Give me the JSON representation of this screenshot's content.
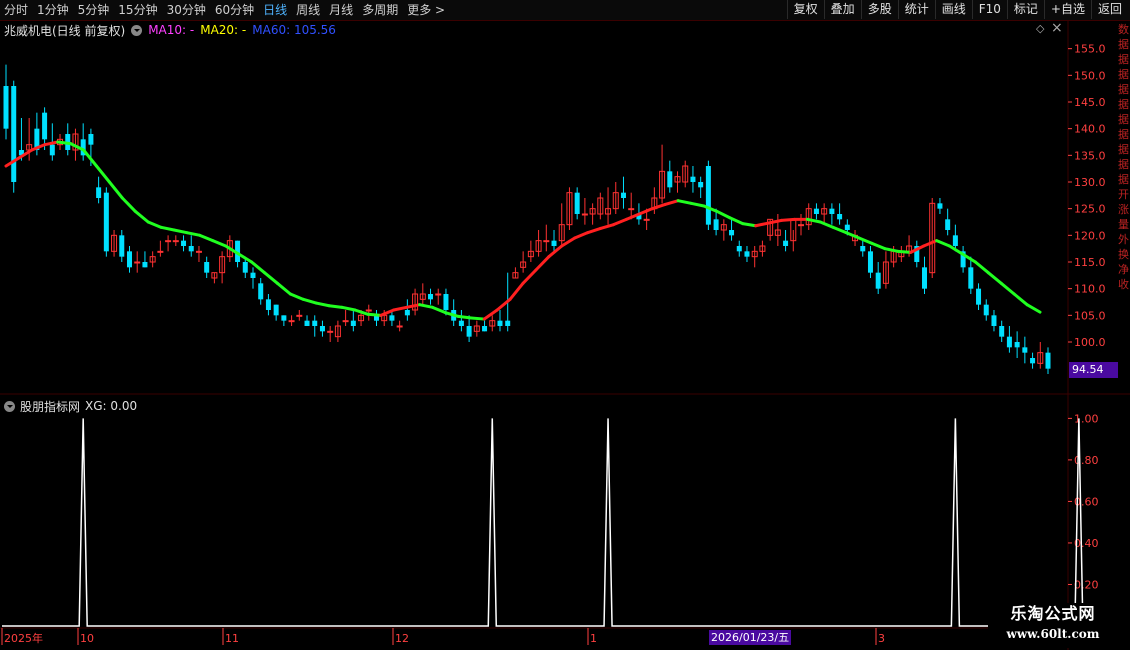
{
  "toolbar": {
    "periods": [
      "分时",
      "1分钟",
      "5分钟",
      "15分钟",
      "30分钟",
      "60分钟",
      "日线",
      "周线",
      "月线",
      "多周期",
      "更多 >"
    ],
    "active_period": "日线",
    "actions": [
      "复权",
      "叠加",
      "多股",
      "统计",
      "画线",
      "F10",
      "标记",
      "+自选",
      "返回"
    ]
  },
  "main_header": {
    "stock": "兆威机电(日线 前复权)",
    "ma10": "MA10: -",
    "ma20": "MA20: -",
    "ma60": "MA60: 105.56"
  },
  "sub_header": {
    "indicator": "股朋指标网",
    "xg": "XG: 0.00"
  },
  "right_strip": [
    "数",
    "据",
    "据",
    "据",
    "据",
    "据",
    "据",
    "据",
    "据",
    "据",
    "据",
    "开",
    "涨",
    "量",
    "外",
    "换",
    "净",
    "收"
  ],
  "last_price": "94.54",
  "date_tag": "2026/01/23/五",
  "watermark": {
    "line1": "乐淘公式网",
    "line2": "www.60lt.com"
  },
  "colors": {
    "up": "#ff3232",
    "down": "#00e0ff",
    "ma10": "#ff40ff",
    "ma20": "#ffff00",
    "ma60": "#3050ff",
    "grid": "#3a0000",
    "axis_text": "#ff4040",
    "signal": "#ffffff"
  },
  "chart_data": [
    {
      "type": "candlestick",
      "price_axis": {
        "ticks": [
          155.0,
          150.0,
          145.0,
          140.0,
          135.0,
          130.0,
          125.0,
          120.0,
          115.0,
          110.0,
          105.0,
          100.0
        ],
        "range": [
          91,
          157
        ]
      },
      "x_labels": [
        "2025年",
        "10",
        "11",
        "12",
        "1",
        "2026/01/23/五",
        "3"
      ],
      "candles": [
        [
          148,
          152,
          140,
          138
        ],
        [
          148,
          149,
          130,
          128
        ],
        [
          136,
          142,
          135,
          134
        ],
        [
          136,
          142,
          137,
          134
        ],
        [
          140,
          143,
          136,
          135
        ],
        [
          143,
          144,
          138,
          136
        ],
        [
          137,
          141,
          135,
          134
        ],
        [
          137,
          139,
          138,
          136
        ],
        [
          139,
          141,
          136,
          135
        ],
        [
          136,
          140,
          139,
          134
        ],
        [
          138,
          141,
          135,
          134
        ],
        [
          139,
          140,
          137,
          133
        ],
        [
          129,
          131,
          127,
          126
        ],
        [
          128,
          129,
          117,
          116
        ],
        [
          117,
          121,
          120,
          116
        ],
        [
          120,
          121,
          116,
          115
        ],
        [
          117,
          118,
          114,
          113
        ],
        [
          115,
          117,
          115,
          113
        ],
        [
          115,
          117,
          114,
          114
        ],
        [
          115,
          117,
          116,
          114
        ],
        [
          117,
          119,
          117,
          116
        ],
        [
          119,
          120,
          119,
          117
        ],
        [
          119,
          120,
          119,
          118
        ],
        [
          119,
          120,
          118,
          117
        ],
        [
          118,
          120,
          117,
          116
        ],
        [
          117,
          118,
          117,
          115
        ],
        [
          115,
          116,
          113,
          112
        ],
        [
          112,
          113,
          113,
          111
        ],
        [
          113,
          117,
          116,
          111
        ],
        [
          116,
          120,
          119,
          115
        ],
        [
          119,
          119,
          115,
          114
        ],
        [
          115,
          116,
          113,
          112
        ],
        [
          113,
          114,
          112,
          110
        ],
        [
          111,
          112,
          108,
          107
        ],
        [
          108,
          109,
          106,
          105
        ],
        [
          107,
          107,
          105,
          104
        ],
        [
          105,
          105,
          104,
          103
        ],
        [
          104,
          105,
          104,
          103
        ],
        [
          105,
          106,
          105,
          104
        ],
        [
          104,
          105,
          103,
          103
        ],
        [
          104,
          105,
          103,
          101
        ],
        [
          103,
          104,
          102,
          101
        ],
        [
          102,
          103,
          102,
          100
        ],
        [
          101,
          104,
          103,
          100
        ],
        [
          104,
          106,
          104,
          103
        ],
        [
          104,
          106,
          103,
          102
        ],
        [
          104,
          106,
          105,
          103
        ],
        [
          106,
          107,
          106,
          104
        ],
        [
          105,
          106,
          104,
          103
        ],
        [
          104,
          106,
          105,
          103
        ],
        [
          105,
          106,
          104,
          103
        ],
        [
          103,
          104,
          103,
          102
        ],
        [
          106,
          108,
          105,
          104
        ],
        [
          106,
          110,
          109,
          105
        ],
        [
          108,
          111,
          109,
          107
        ],
        [
          109,
          110,
          108,
          107
        ],
        [
          109,
          110,
          109,
          107
        ],
        [
          109,
          110,
          106,
          105
        ],
        [
          106,
          108,
          104,
          103
        ],
        [
          104,
          106,
          103,
          102
        ],
        [
          103,
          105,
          101,
          100
        ],
        [
          102,
          104,
          103,
          101
        ],
        [
          103,
          104,
          102,
          102
        ],
        [
          103,
          105,
          104,
          102
        ],
        [
          104,
          106,
          103,
          102
        ],
        [
          104,
          113,
          103,
          102
        ],
        [
          112,
          114,
          113,
          112
        ],
        [
          114,
          117,
          115,
          113
        ],
        [
          116,
          119,
          117,
          115
        ],
        [
          117,
          121,
          119,
          116
        ],
        [
          119,
          122,
          119,
          117
        ],
        [
          119,
          121,
          118,
          117
        ],
        [
          119,
          126,
          122,
          118
        ],
        [
          122,
          129,
          128,
          121
        ],
        [
          128,
          129,
          124,
          123
        ],
        [
          124,
          127,
          124,
          122
        ],
        [
          124,
          126,
          125,
          122
        ],
        [
          124,
          128,
          127,
          123
        ],
        [
          124,
          129,
          125,
          122
        ],
        [
          125,
          130,
          128,
          124
        ],
        [
          128,
          131,
          127,
          125
        ],
        [
          125,
          128,
          125,
          123
        ],
        [
          124,
          126,
          123,
          122
        ],
        [
          123,
          125,
          123,
          121
        ],
        [
          125,
          129,
          127,
          124
        ],
        [
          127,
          137,
          132,
          126
        ],
        [
          132,
          134,
          129,
          128
        ],
        [
          130,
          132,
          131,
          128
        ],
        [
          130,
          134,
          133,
          129
        ],
        [
          131,
          133,
          130,
          128
        ],
        [
          130,
          131,
          129,
          127
        ],
        [
          133,
          134,
          122,
          121
        ],
        [
          123,
          125,
          121,
          120
        ],
        [
          121,
          123,
          122,
          119
        ],
        [
          121,
          123,
          120,
          119
        ],
        [
          118,
          119,
          117,
          116
        ],
        [
          117,
          118,
          116,
          115
        ],
        [
          116,
          118,
          117,
          114
        ],
        [
          117,
          119,
          118,
          116
        ],
        [
          120,
          123,
          123,
          119
        ],
        [
          120,
          124,
          121,
          118
        ],
        [
          119,
          121,
          118,
          117
        ],
        [
          119,
          121,
          123,
          117
        ],
        [
          122,
          124,
          122,
          120
        ],
        [
          122,
          126,
          125,
          121
        ],
        [
          125,
          126,
          124,
          123
        ],
        [
          124,
          126,
          125,
          122
        ],
        [
          125,
          126,
          124,
          122
        ],
        [
          124,
          126,
          123,
          122
        ],
        [
          122,
          123,
          121,
          120
        ],
        [
          119,
          121,
          120,
          118
        ],
        [
          118,
          119,
          117,
          116
        ],
        [
          117,
          118,
          113,
          112
        ],
        [
          113,
          115,
          110,
          109
        ],
        [
          111,
          117,
          115,
          110
        ],
        [
          115,
          118,
          117,
          114
        ],
        [
          116,
          118,
          117,
          115
        ],
        [
          117,
          120,
          118,
          116
        ],
        [
          118,
          119,
          115,
          114
        ],
        [
          114,
          116,
          110,
          109
        ],
        [
          113,
          127,
          126,
          112
        ],
        [
          126,
          127,
          125,
          124
        ],
        [
          123,
          125,
          121,
          120
        ],
        [
          120,
          122,
          118,
          117
        ],
        [
          117,
          118,
          114,
          113
        ],
        [
          114,
          116,
          110,
          109
        ],
        [
          110,
          111,
          107,
          106
        ],
        [
          107,
          108,
          105,
          104
        ],
        [
          105,
          106,
          103,
          102
        ],
        [
          103,
          104,
          101,
          100
        ],
        [
          101,
          103,
          99,
          98
        ],
        [
          100,
          102,
          99,
          97
        ],
        [
          99,
          101,
          98,
          96
        ],
        [
          97,
          98,
          96,
          95
        ],
        [
          96,
          100,
          98,
          95
        ],
        [
          98,
          99,
          95,
          94
        ]
      ],
      "ma_line": [
        133,
        134.5,
        136,
        137,
        137.5,
        137.2,
        136,
        133,
        130,
        127,
        124.5,
        122.5,
        121.5,
        121,
        120.5,
        120,
        119,
        118,
        116.5,
        115,
        113,
        111,
        109,
        108,
        107.3,
        106.8,
        106.5,
        106,
        105.2,
        105,
        106,
        106.5,
        107,
        106.5,
        105.5,
        104.8,
        104.5,
        104.3,
        106,
        108,
        111,
        113.5,
        116,
        118,
        119.5,
        120.5,
        121.3,
        122,
        123,
        124,
        125,
        125.8,
        126.5,
        126,
        125.5,
        124.5,
        123.3,
        122.2,
        121.8,
        122.3,
        122.8,
        123,
        123,
        122.5,
        121.5,
        120.5,
        119.5,
        118.5,
        117.5,
        117,
        116.8,
        118,
        119,
        118,
        116.5,
        115,
        113,
        111,
        109,
        107,
        105.6
      ]
    },
    {
      "type": "line",
      "name": "XG",
      "y_ticks": [
        1.0,
        0.8,
        0.6,
        0.4,
        0.2
      ],
      "range": [
        0,
        1.05
      ],
      "spikes_at_candle": [
        10,
        63,
        78,
        123,
        139
      ]
    }
  ]
}
